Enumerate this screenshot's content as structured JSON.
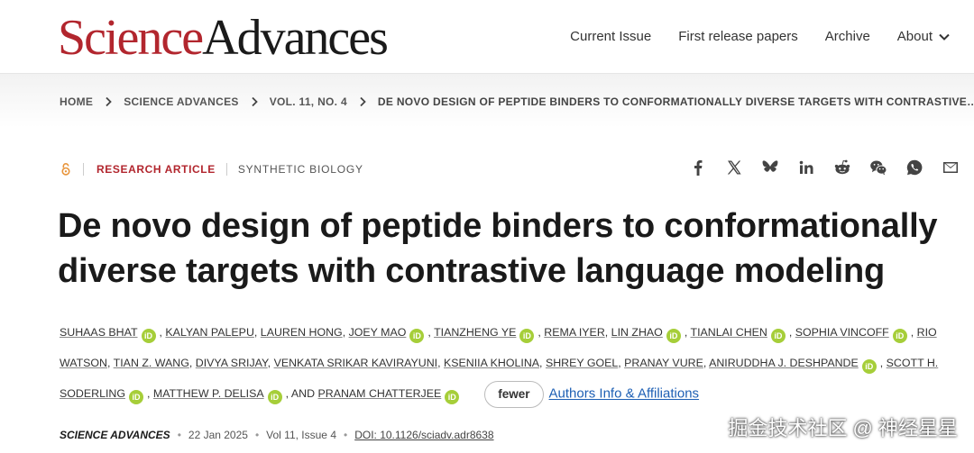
{
  "brand": {
    "science": "Science",
    "advances": "Advances"
  },
  "nav": [
    "Current Issue",
    "First release papers",
    "Archive",
    "About"
  ],
  "breadcrumb": [
    "HOME",
    "SCIENCE ADVANCES",
    "VOL. 11, NO. 4",
    "DE NOVO DESIGN OF PEPTIDE BINDERS TO CONFORMATIONALLY DIVERSE TARGETS WITH CONTRASTIVE…"
  ],
  "article": {
    "type": "RESEARCH ARTICLE",
    "subject": "SYNTHETIC BIOLOGY",
    "title": "De novo design of peptide binders to conformationally diverse targets with contrastive language modeling"
  },
  "share_icons": [
    "facebook-icon",
    "x-icon",
    "bluesky-icon",
    "linkedin-icon",
    "reddit-icon",
    "wechat-icon",
    "whatsapp-icon",
    "email-icon"
  ],
  "authors": [
    {
      "name": "Suhaas Bhat",
      "orcid": true
    },
    {
      "name": "Kalyan Palepu",
      "orcid": false
    },
    {
      "name": "Lauren Hong",
      "orcid": false
    },
    {
      "name": "Joey Mao",
      "orcid": true
    },
    {
      "name": "Tianzheng Ye",
      "orcid": true
    },
    {
      "name": "Rema Iyer",
      "orcid": false
    },
    {
      "name": "Lin Zhao",
      "orcid": true
    },
    {
      "name": "Tianlai Chen",
      "orcid": true
    },
    {
      "name": "Sophia Vincoff",
      "orcid": true
    },
    {
      "name": "Rio Watson",
      "orcid": false
    },
    {
      "name": "Tian Z. Wang",
      "orcid": false
    },
    {
      "name": "Divya Srijay",
      "orcid": false
    },
    {
      "name": "Venkata Srikar Kavirayuni",
      "orcid": false
    },
    {
      "name": "Kseniia Kholina",
      "orcid": false
    },
    {
      "name": "Shrey Goel",
      "orcid": false
    },
    {
      "name": "Pranay Vure",
      "orcid": false
    },
    {
      "name": "Aniruddha J. Deshpande",
      "orcid": true
    },
    {
      "name": "Scott H. Soderling",
      "orcid": true
    },
    {
      "name": "Matthew P. DeLisa",
      "orcid": true
    },
    {
      "name": "Pranam Chatterjee",
      "orcid": true
    }
  ],
  "authors_and": "AND",
  "orcid_glyph": "iD",
  "fewer_label": "fewer",
  "affiliations_label": "Authors Info & Affiliations",
  "pub": {
    "journal": "SCIENCE ADVANCES",
    "date": "22 Jan 2025",
    "volume": "Vol 11, Issue 4",
    "doi": "DOI: 10.1126/sciadv.adr8638"
  },
  "watermark": "掘金技术社区 @ 神经星星",
  "colors": {
    "brand_red": "#b2262e",
    "orcid_green": "#a6ce39",
    "link_blue": "#1d5fb4"
  }
}
